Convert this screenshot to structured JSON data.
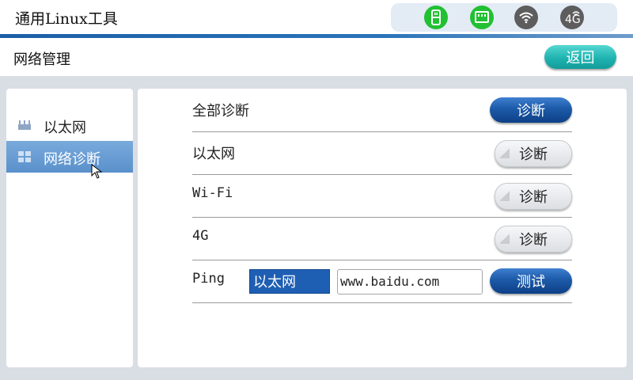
{
  "app": {
    "title": "通用Linux工具"
  },
  "status_icons": [
    {
      "name": "usb-icon",
      "color": "#22c033"
    },
    {
      "name": "ethernet-icon",
      "color": "#22c033"
    },
    {
      "name": "wifi-icon",
      "color": "#5d5d5d"
    },
    {
      "name": "4g-icon",
      "label": "4G",
      "color": "#5d5d5d"
    }
  ],
  "page": {
    "title": "网络管理",
    "back_label": "返回"
  },
  "sidebar": {
    "items": [
      {
        "label": "以太网",
        "icon": "router-icon",
        "active": false
      },
      {
        "label": "网络诊断",
        "icon": "grid-icon",
        "active": true
      }
    ]
  },
  "diagnostics": {
    "rows": [
      {
        "label": "全部诊断",
        "button": "诊断",
        "style": "primary"
      },
      {
        "label": "以太网",
        "button": "诊断",
        "style": "secondary"
      },
      {
        "label": "Wi-Fi",
        "button": "诊断",
        "style": "secondary"
      },
      {
        "label": "4G",
        "button": "诊断",
        "style": "secondary"
      }
    ],
    "ping": {
      "label": "Ping",
      "interface": "以太网",
      "host": "www.baidu.com",
      "button": "测试"
    }
  }
}
